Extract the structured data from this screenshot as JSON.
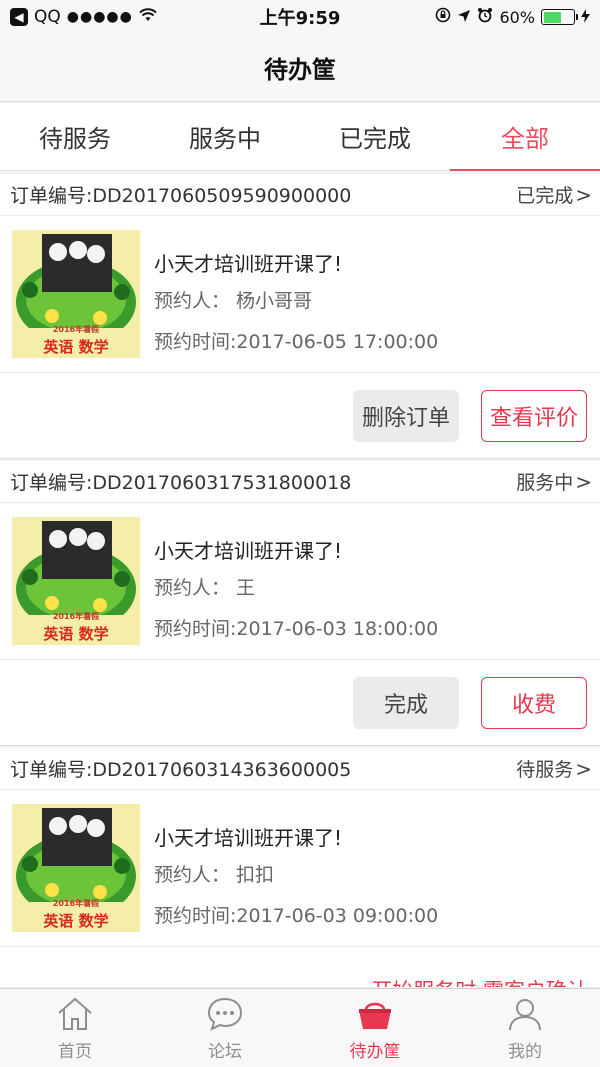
{
  "status_bar": {
    "carrier": "QQ",
    "signal": "●●●●●",
    "time": "上午9:59",
    "battery": "60%",
    "battery_level": 0.6
  },
  "nav": {
    "title": "待办筐"
  },
  "tabs": [
    {
      "label": "待服务",
      "active": false
    },
    {
      "label": "服务中",
      "active": false
    },
    {
      "label": "已完成",
      "active": false
    },
    {
      "label": "全部",
      "active": true
    }
  ],
  "orders": [
    {
      "order_no": "订单编号:DD20170605095909000​00",
      "status": "已完成",
      "title": "小天才培训班开课了!",
      "booker": "预约人： 杨小哥哥",
      "time": "预约时间:2017-06-05 17:00:00",
      "btn_gray": "删除订单",
      "btn_red": "查看评价"
    },
    {
      "order_no": "订单编号:DD201706031753180​0018",
      "status": "服务中",
      "title": "小天才培训班开课了!",
      "booker": "预约人： 王",
      "time": "预约时间:2017-06-03 18:00:00",
      "btn_gray": "完成",
      "btn_red": "收费"
    },
    {
      "order_no": "订单编号:DD201706031436360​0005",
      "status": "待服务",
      "title": "小天才培训班开课了!",
      "booker": "预约人： 扣扣",
      "time": "预约时间:2017-06-03 09:00:00"
    }
  ],
  "partial_text": "开始服务时,需客户确认",
  "thumb": {
    "year_text": "2016年暑假",
    "subject_text": "英语  数学"
  },
  "tabbar": [
    {
      "label": "首页",
      "icon": "home-icon",
      "active": false
    },
    {
      "label": "论坛",
      "icon": "chat-icon",
      "active": false
    },
    {
      "label": "待办筐",
      "icon": "basket-icon",
      "active": true
    },
    {
      "label": "我的",
      "icon": "user-icon",
      "active": false
    }
  ],
  "colors": {
    "accent": "#e8384f",
    "tab_active": "#f04a5e"
  }
}
